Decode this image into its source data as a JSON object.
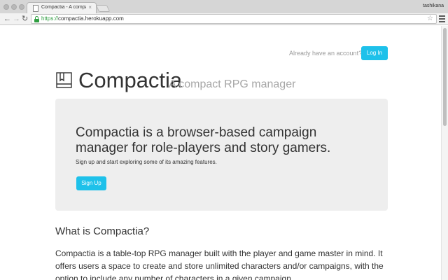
{
  "browser": {
    "tab_title": "Compactia - A compact RPG",
    "tab_close": "×",
    "user": "tashikana",
    "url_scheme": "https://",
    "url_rest": "compactia.herokuapp.com",
    "back_glyph": "←",
    "forward_glyph": "→",
    "reload_glyph": "↻",
    "star_glyph": "☆"
  },
  "header": {
    "already_text": "Already have an account?",
    "login_label": "Log In"
  },
  "brand": {
    "name": "Compactia",
    "tagline": "A compact RPG manager",
    "icon": "book-icon"
  },
  "hero": {
    "headline": "Compactia is a browser-based campaign manager for role-players and story gamers.",
    "subtext": "Sign up and start exploring some of its amazing features.",
    "signup_label": "Sign Up"
  },
  "about": {
    "title": "What is Compactia?",
    "body": "Compactia is a table-top RPG manager built with the player and game master in mind. It offers users a space to create and store unlimited characters and/or campaigns, with the option to include any number of characters in a given campaign."
  },
  "colors": {
    "accent": "#1ec1ea",
    "text": "#333333",
    "muted": "#a6a6a6",
    "jumbotron_bg": "#eeeeee"
  }
}
